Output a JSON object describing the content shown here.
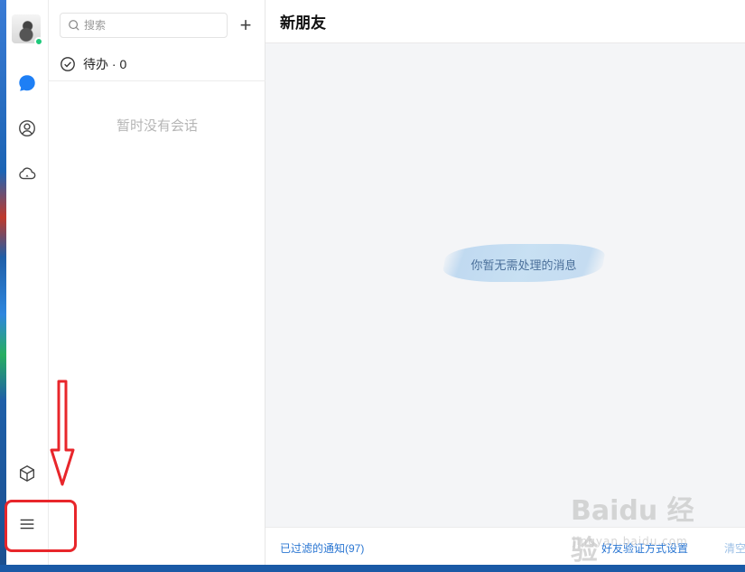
{
  "app": {
    "search": {
      "placeholder": "搜索"
    },
    "add_label": "+",
    "todo": {
      "label": "待办 · 0"
    },
    "session_empty": "暂时没有会话",
    "main": {
      "title": "新朋友",
      "empty_message": "你暂无需处理的消息",
      "footer": {
        "filtered_notices": "已过滤的通知(97)",
        "verify_settings": "好友验证方式设置",
        "clear": "清空"
      }
    }
  },
  "rail_icons": [
    "avatar",
    "message-icon",
    "contacts-icon",
    "cloud-icon",
    "apps-cube-icon",
    "menu-icon"
  ],
  "watermark": {
    "text": "Baidu 经验",
    "sub": "jingyan.baidu.com"
  },
  "colors": {
    "accent": "#2a76d2",
    "online": "#1ec97b",
    "annotation": "#e8262b",
    "main_bg": "#f4f5f7"
  }
}
